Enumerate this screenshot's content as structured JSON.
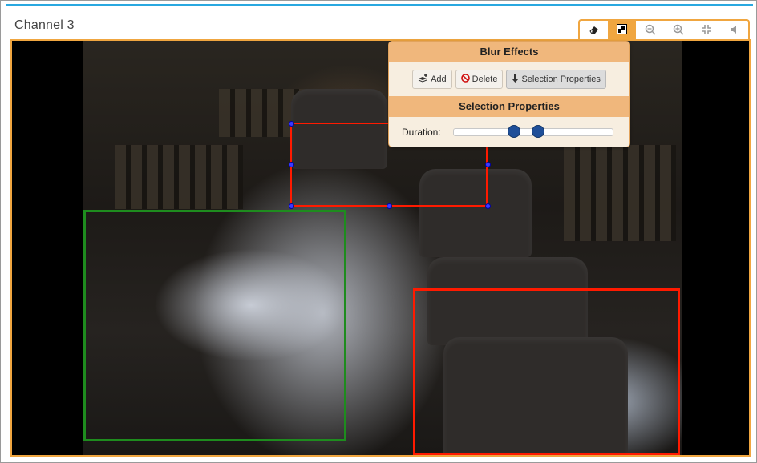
{
  "channel": {
    "title": "Channel 3"
  },
  "toolbar": {
    "buttons": [
      {
        "icon": "eraser-icon",
        "glyph": "⌫",
        "active": false
      },
      {
        "icon": "blur-effects-icon",
        "glyph": "▚",
        "active": true
      },
      {
        "icon": "zoom-out-icon",
        "glyph": "−",
        "active": false
      },
      {
        "icon": "zoom-in-icon",
        "glyph": "+",
        "active": false
      },
      {
        "icon": "exit-fullscreen-icon",
        "glyph": "⇲",
        "active": false
      },
      {
        "icon": "volume-icon",
        "glyph": "◀",
        "active": false
      }
    ]
  },
  "blur_panel": {
    "title": "Blur Effects",
    "add_label": "Add",
    "delete_label": "Delete",
    "selection_properties_label": "Selection Properties",
    "section_title": "Selection Properties",
    "duration_label": "Duration:",
    "duration_range": [
      0.38,
      0.53
    ]
  },
  "colors": {
    "accent": "#f0a640",
    "top_bar": "#29a8e0",
    "selected_box": "#ff1a00",
    "blur_box_green": "#1e8c1e",
    "handle": "#3b3bff"
  }
}
